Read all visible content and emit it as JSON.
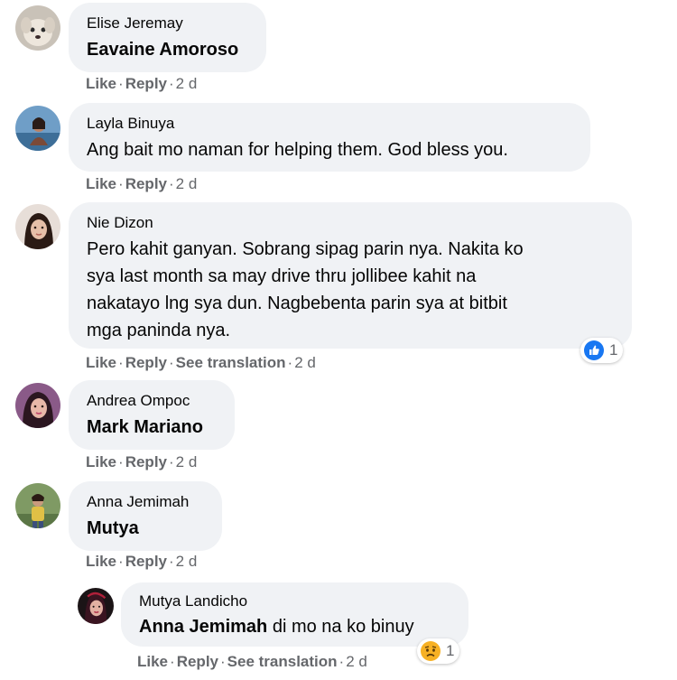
{
  "comments": [
    {
      "author": "Elise Jeremay",
      "text": "Eavaine Amoroso",
      "actions": {
        "like": "Like",
        "reply": "Reply",
        "time": "2 d"
      }
    },
    {
      "author": "Layla Binuya",
      "text": "Ang bait mo naman for helping them. God bless you.",
      "actions": {
        "like": "Like",
        "reply": "Reply",
        "time": "2 d"
      }
    },
    {
      "author": "Nie Dizon",
      "text_lines": [
        "Pero kahit ganyan. Sobrang sipag parin nya. Nakita ko",
        "sya last month sa may drive thru jollibee kahit na",
        "nakatayo lng sya dun. Nagbebenta parin sya at bitbit",
        "mga paninda nya."
      ],
      "actions": {
        "like": "Like",
        "reply": "Reply",
        "see_translation": "See translation",
        "time": "2 d"
      },
      "reaction": {
        "icon": "like-reaction-icon",
        "count": "1",
        "color": "#1877f2"
      }
    },
    {
      "author": "Andrea Ompoc",
      "text": "Mark Mariano",
      "actions": {
        "like": "Like",
        "reply": "Reply",
        "time": "2 d"
      }
    },
    {
      "author": "Anna Jemimah",
      "text": "Mutya",
      "actions": {
        "like": "Like",
        "reply": "Reply",
        "time": "2 d"
      }
    },
    {
      "author": "Mutya Landicho",
      "mention": "Anna Jemimah",
      "text": "di mo na ko binuy",
      "actions": {
        "like": "Like",
        "reply": "Reply",
        "see_translation": "See translation",
        "time": "2 d"
      },
      "reaction": {
        "icon": "sad-reaction-icon",
        "count": "1",
        "color": "#f7b125"
      }
    }
  ],
  "separator": "·"
}
